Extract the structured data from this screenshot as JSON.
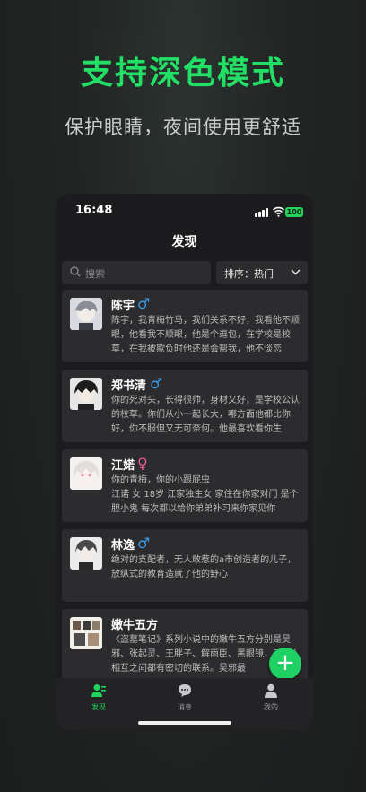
{
  "hero": {
    "title": "支持深色模式",
    "subtitle": "保护眼睛，夜间使用更舒适"
  },
  "status_bar": {
    "time": "16:48",
    "battery": "100"
  },
  "nav": {
    "title": "发现"
  },
  "search": {
    "placeholder": "搜索"
  },
  "sort": {
    "label": "排序：热门"
  },
  "cards": [
    {
      "name": "陈宇",
      "gender": "♂",
      "desc": "陈宇，我青梅竹马，我们关系不好，我看他不顺眼，他看我不顺眼，他是个逗包，在学校是校草，在我被欺负时他还是会帮我，他不谈恋"
    },
    {
      "name": "郑书清",
      "gender": "♂",
      "desc": "你的死对头，长得很帅，身材又好，是学校公认的校草。你们从小一起长大，哪方面他都比你好，你不服但又无可奈何。他最喜欢看你生"
    },
    {
      "name": "江婼",
      "gender": "♀",
      "desc": "你的青梅，你的小跟屁虫\n江诺 女 18岁 江家独生女 家住在你家对门 是个胆小鬼 每次都以给你弟弟补习来你家见你"
    },
    {
      "name": "林逸",
      "gender": "♂",
      "desc": "绝对的支配者，无人敢惹的a市创造者的儿子，放纵式的教育造就了他的野心"
    },
    {
      "name": "嫩牛五方",
      "gender": "",
      "desc": "《盗墓笔记》系列小说中的嫩牛五方分别是吴邪、张起灵、王胖子、解雨臣、黑眼镜，五个人相互之间都有密切的联系。吴邪最"
    },
    {
      "name": "",
      "gender": "",
      "desc": ""
    }
  ],
  "tabs": [
    {
      "label": "发现",
      "icon": "discover-icon",
      "active": true
    },
    {
      "label": "消息",
      "icon": "message-icon",
      "active": false
    },
    {
      "label": "我的",
      "icon": "profile-icon",
      "active": false
    }
  ],
  "fab": {
    "label": "+"
  },
  "colors": {
    "accent": "#22d35e",
    "male": "#3a9be8",
    "female": "#e85b8c",
    "card": "#2c2c2e",
    "background": "#1c1c1e"
  }
}
